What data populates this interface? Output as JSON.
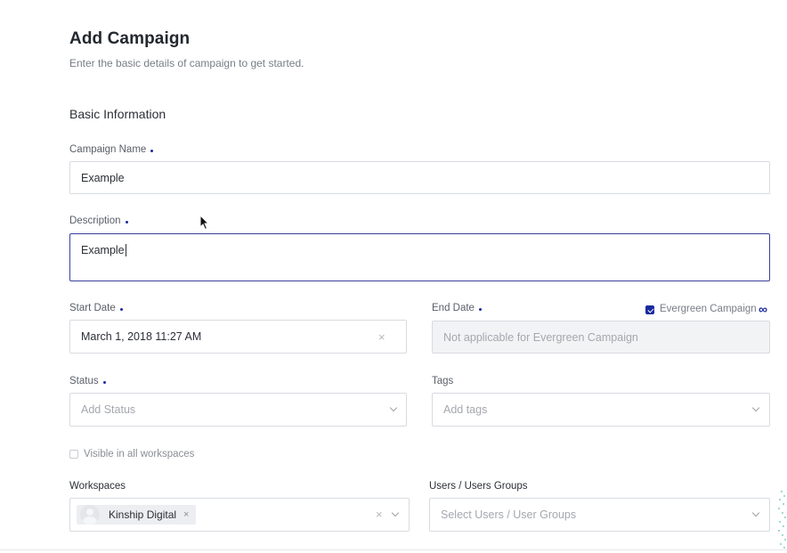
{
  "header": {
    "title": "Add Campaign",
    "subtitle": "Enter the basic details of campaign to get started."
  },
  "section": {
    "title": "Basic Information"
  },
  "fields": {
    "campaign_name": {
      "label": "Campaign Name",
      "value": "Example",
      "required": true
    },
    "description": {
      "label": "Description",
      "value": "Example",
      "required": true
    },
    "start_date": {
      "label": "Start Date",
      "value": "March 1, 2018 11:27 AM",
      "required": true,
      "clear": "×"
    },
    "end_date": {
      "label": "End Date",
      "placeholder": "Not applicable for Evergreen Campaign",
      "required": true
    },
    "evergreen": {
      "label": "Evergreen Campaign",
      "checked": true,
      "symbol": "∞"
    },
    "status": {
      "label": "Status",
      "placeholder": "Add Status",
      "required": true
    },
    "tags": {
      "label": "Tags",
      "placeholder": "Add tags"
    },
    "visible_all": {
      "label": "Visible in all workspaces",
      "checked": false
    },
    "workspaces": {
      "label": "Workspaces",
      "chip": "Kinship Digital",
      "chip_remove": "×",
      "clear": "×"
    },
    "users": {
      "label": "Users / Users Groups",
      "placeholder": "Select Users / User Groups"
    }
  },
  "colors": {
    "accent": "#1a2a9e",
    "focus_border": "#3a3f9e",
    "border": "#d8dbe0"
  }
}
